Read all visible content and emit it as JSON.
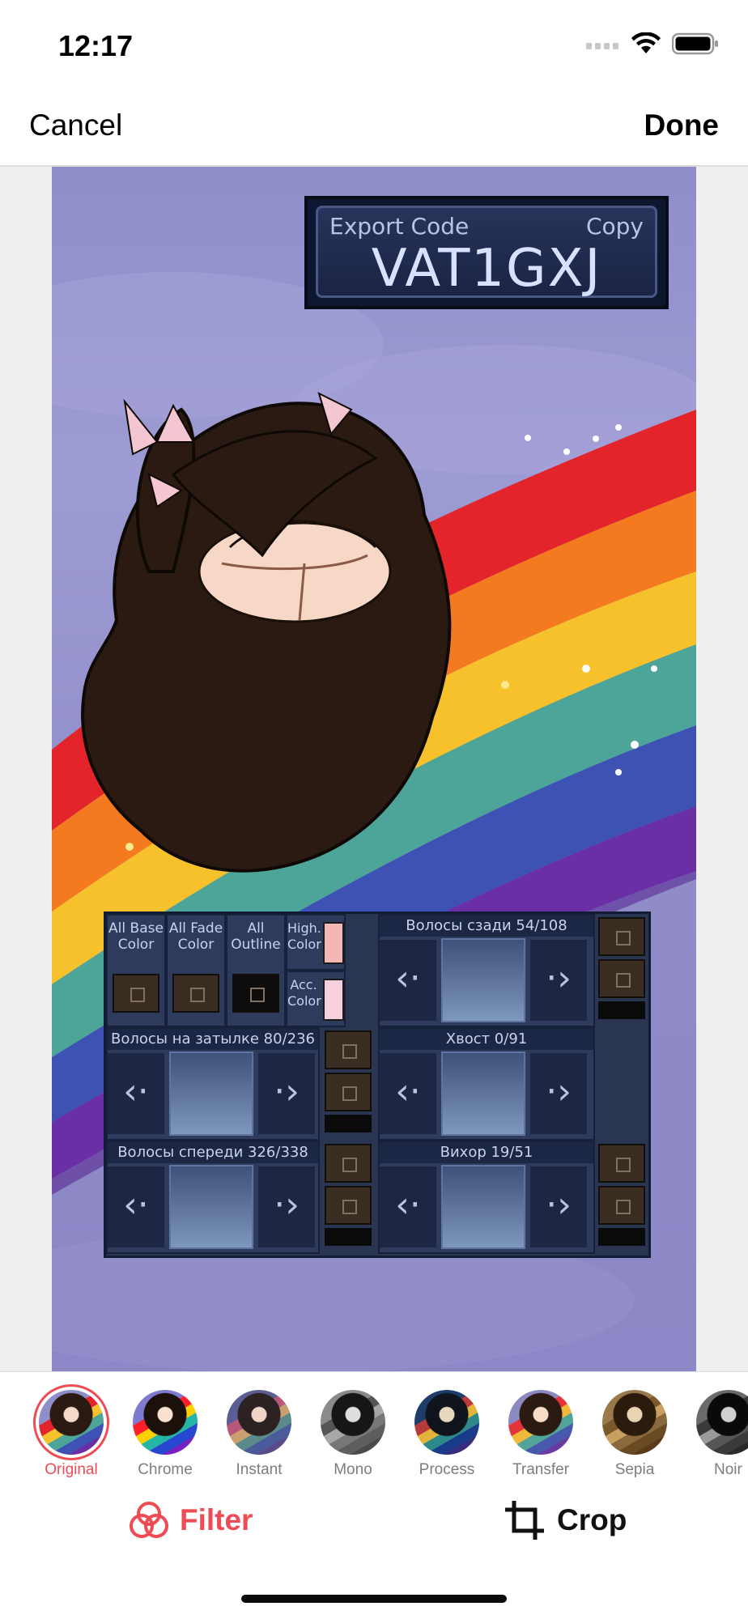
{
  "status_bar": {
    "time": "12:17"
  },
  "nav": {
    "cancel_label": "Cancel",
    "done_label": "Done"
  },
  "photo": {
    "export_label": "Export Code",
    "copy_label": "Copy",
    "export_code": "VAT1GXJ",
    "panel": {
      "all_base_color": "All Base Color",
      "all_fade_color": "All Fade Color",
      "all_outline": "All Outline",
      "high_color": "High. Color",
      "acc_color": "Acc. Color",
      "back_hair": "Волосы сзади 54/108",
      "nape_hair": "Волосы на затылке 80/236",
      "tail": "Хвост 0/91",
      "front_hair": "Волосы спереди 326/338",
      "whirl": "Вихор 19/51",
      "arrow_left": "‹·",
      "arrow_right": "·›"
    }
  },
  "filters": [
    {
      "name": "Original",
      "selected": true
    },
    {
      "name": "Chrome",
      "selected": false
    },
    {
      "name": "Instant",
      "selected": false
    },
    {
      "name": "Mono",
      "selected": false
    },
    {
      "name": "Process",
      "selected": false
    },
    {
      "name": "Transfer",
      "selected": false
    },
    {
      "name": "Sepia",
      "selected": false
    },
    {
      "name": "Noir",
      "selected": false
    }
  ],
  "modes": {
    "filter_label": "Filter",
    "crop_label": "Crop"
  },
  "colors": {
    "accent": "#ee4b54"
  }
}
